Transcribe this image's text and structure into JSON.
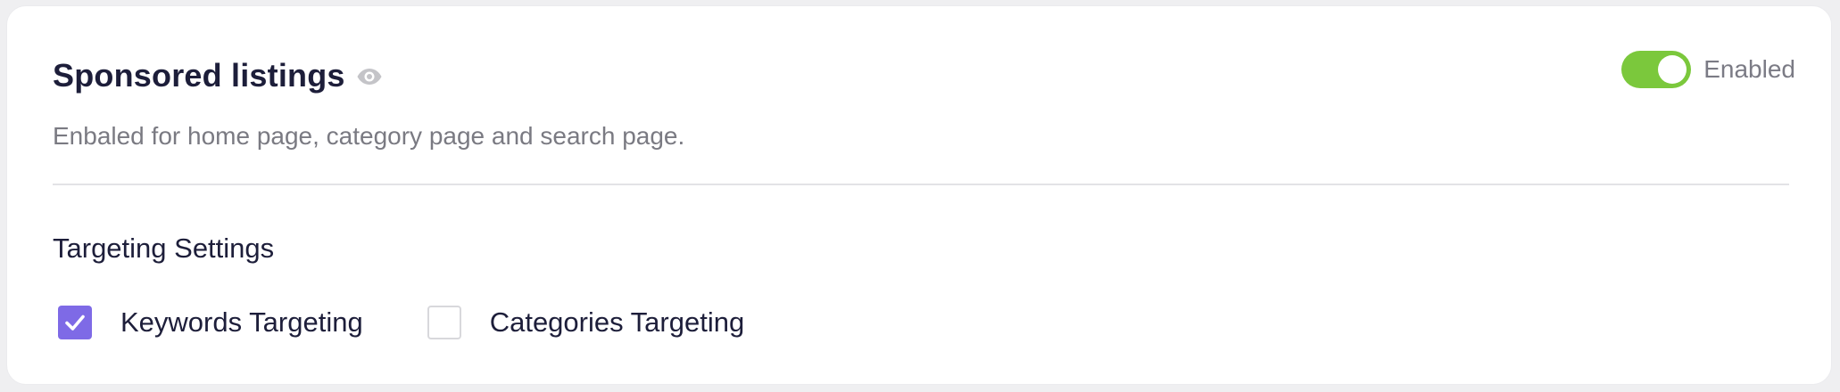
{
  "sponsored": {
    "title": "Sponsored listings",
    "visibility_icon": "eye-icon",
    "description": "Enbaled for home page, category page and search page.",
    "toggle": {
      "label": "Enabled",
      "checked": true,
      "color": "#7bc83c"
    }
  },
  "targeting": {
    "section_title": "Targeting Settings",
    "options": [
      {
        "label": "Keywords Targeting",
        "checked": true
      },
      {
        "label": "Categories Targeting",
        "checked": false
      }
    ],
    "checkbox_accent": "#7e6ae6"
  }
}
